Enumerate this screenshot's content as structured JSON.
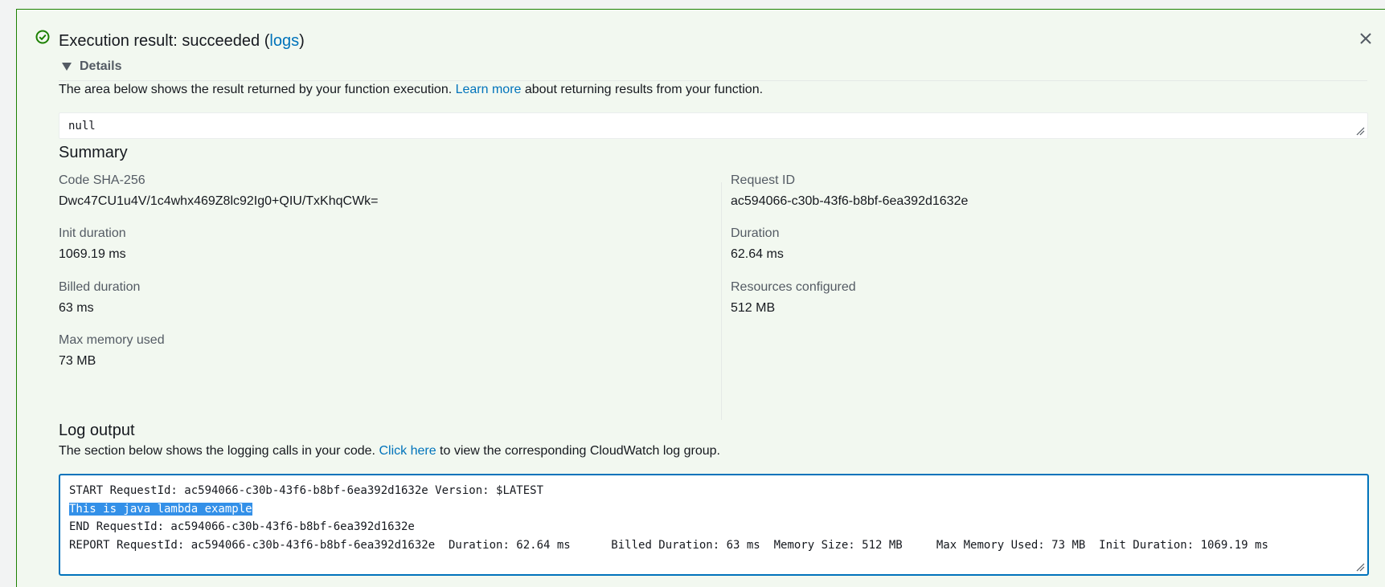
{
  "result": {
    "title_prefix": "Execution result: succeeded (",
    "logs_link": "logs",
    "title_suffix": ")",
    "status_color": "#1d8102"
  },
  "details": {
    "label": "Details",
    "desc_prefix": "The area below shows the result returned by your function execution. ",
    "learn_more": "Learn more",
    "desc_suffix": " about returning results from your function.",
    "result_value": "null"
  },
  "summary": {
    "title": "Summary",
    "left": [
      {
        "label": "Code SHA-256",
        "value": "Dwc47CU1u4V/1c4whx469Z8lc92Ig0+QIU/TxKhqCWk="
      },
      {
        "label": "Init duration",
        "value": "1069.19 ms"
      },
      {
        "label": "Billed duration",
        "value": "63 ms"
      },
      {
        "label": "Max memory used",
        "value": "73 MB"
      }
    ],
    "right": [
      {
        "label": "Request ID",
        "value": "ac594066-c30b-43f6-b8bf-6ea392d1632e"
      },
      {
        "label": "Duration",
        "value": "62.64 ms"
      },
      {
        "label": "Resources configured",
        "value": "512 MB"
      }
    ]
  },
  "log": {
    "title": "Log output",
    "desc_prefix": "The section below shows the logging calls in your code. ",
    "click_here": "Click here",
    "desc_suffix": " to view the corresponding CloudWatch log group.",
    "lines": [
      "START RequestId: ac594066-c30b-43f6-b8bf-6ea392d1632e Version: $LATEST",
      "This is java lambda example",
      "END RequestId: ac594066-c30b-43f6-b8bf-6ea392d1632e",
      "REPORT RequestId: ac594066-c30b-43f6-b8bf-6ea392d1632e  Duration: 62.64 ms      Billed Duration: 63 ms  Memory Size: 512 MB     Max Memory Used: 73 MB  Init Duration: 1069.19 ms"
    ],
    "highlight_color": "#3390e8"
  },
  "icons": {
    "status": "check-circle-icon",
    "close": "close-icon",
    "toggle": "caret-down-icon",
    "resize": "resize-handle-icon"
  }
}
